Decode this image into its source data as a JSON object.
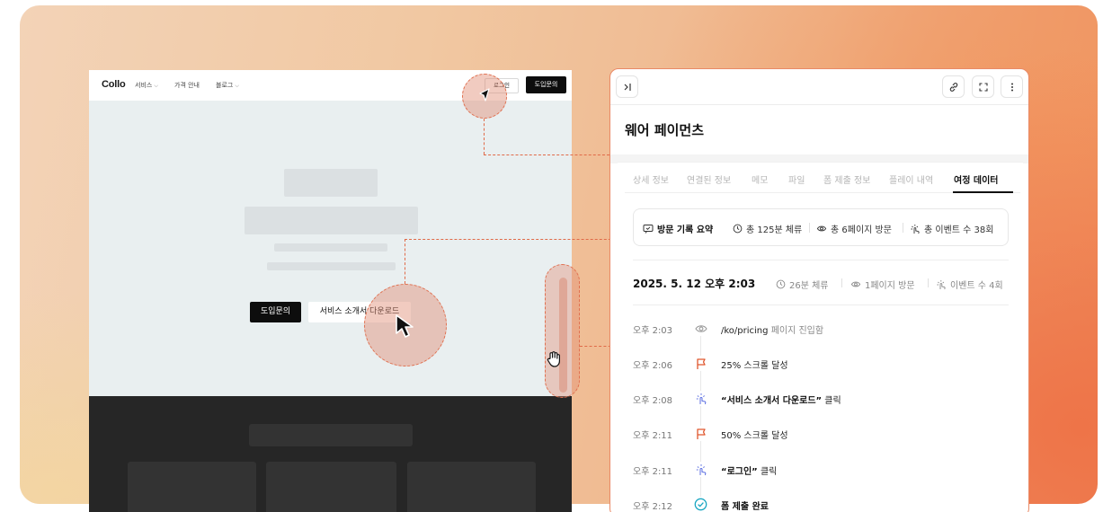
{
  "site": {
    "logo": "Collo",
    "nav": [
      "서비스",
      "가격 안내",
      "블로그"
    ],
    "login": "로그인",
    "cta": "도입문의",
    "hero_primary": "도입문의",
    "hero_secondary": "서비스 소개서 다운로드"
  },
  "panel": {
    "title": "웨어 페이먼츠",
    "icons": [
      "collapse-panel-icon",
      "link-icon",
      "expand-icon",
      "more-vertical-icon"
    ],
    "tabs": [
      {
        "label": "상세 정보",
        "active": false
      },
      {
        "label": "연결된 정보",
        "active": false
      },
      {
        "label": "메모",
        "active": false
      },
      {
        "label": "파일",
        "active": false
      },
      {
        "label": "폼 제출 정보",
        "active": false
      },
      {
        "label": "플레이 내역",
        "active": false
      },
      {
        "label": "여정 데이터",
        "active": true
      }
    ],
    "summary": {
      "title": "방문 기록 요약",
      "duration": "총 125분 체류",
      "pages": "총 6페이지 방문",
      "events": "총 이벤트 수 38회"
    },
    "visit": {
      "date": "2025. 5. 12 오후 2:03",
      "duration": "26분 체류",
      "pages": "1페이지 방문",
      "events": "이벤트 수 4회"
    },
    "events": [
      {
        "time": "오후 2:03",
        "icon": "eye-icon",
        "main": "/ko/pricing",
        "suffix": "페이지 진입함"
      },
      {
        "time": "오후 2:06",
        "icon": "flag-icon",
        "main": "25% 스크롤 달성",
        "suffix": ""
      },
      {
        "time": "오후 2:08",
        "icon": "click-icon",
        "main": "“서비스 소개서 다운로드”",
        "suffix": "클릭"
      },
      {
        "time": "오후 2:11",
        "icon": "flag-icon",
        "main": "50% 스크롤 달성",
        "suffix": ""
      },
      {
        "time": "오후 2:11",
        "icon": "click-icon",
        "main": "“로그인”",
        "suffix": "클릭"
      },
      {
        "time": "오후 2:12",
        "icon": "check-circle-icon",
        "main": "폼 제출 완료",
        "suffix": ""
      }
    ]
  },
  "colors": {
    "accent": "#e06a48",
    "flag": "#e0572e",
    "click": "#5b6ee0",
    "check": "#1aa7c2"
  }
}
